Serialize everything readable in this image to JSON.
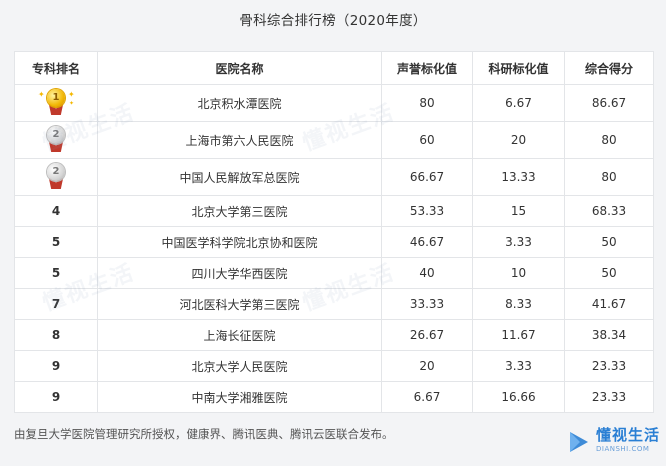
{
  "title": "骨科综合排行榜（2020年度）",
  "table": {
    "headers": [
      "专科排名",
      "医院名称",
      "声誉标化值",
      "科研标化值",
      "综合得分"
    ],
    "rows": [
      {
        "rank": "1",
        "medal": "gold",
        "name": "北京积水潭医院",
        "reputation": "80",
        "research": "6.67",
        "total": "86.67"
      },
      {
        "rank": "2",
        "medal": "silver",
        "name": "上海市第六人民医院",
        "reputation": "60",
        "research": "20",
        "total": "80"
      },
      {
        "rank": "2",
        "medal": "silver",
        "name": "中国人民解放军总医院",
        "reputation": "66.67",
        "research": "13.33",
        "total": "80"
      },
      {
        "rank": "4",
        "medal": "",
        "name": "北京大学第三医院",
        "reputation": "53.33",
        "research": "15",
        "total": "68.33"
      },
      {
        "rank": "5",
        "medal": "",
        "name": "中国医学科学院北京协和医院",
        "reputation": "46.67",
        "research": "3.33",
        "total": "50"
      },
      {
        "rank": "5",
        "medal": "",
        "name": "四川大学华西医院",
        "reputation": "40",
        "research": "10",
        "total": "50"
      },
      {
        "rank": "7",
        "medal": "",
        "name": "河北医科大学第三医院",
        "reputation": "33.33",
        "research": "8.33",
        "total": "41.67"
      },
      {
        "rank": "8",
        "medal": "",
        "name": "上海长征医院",
        "reputation": "26.67",
        "research": "11.67",
        "total": "38.34"
      },
      {
        "rank": "9",
        "medal": "",
        "name": "北京大学人民医院",
        "reputation": "20",
        "research": "3.33",
        "total": "23.33"
      },
      {
        "rank": "9",
        "medal": "",
        "name": "中南大学湘雅医院",
        "reputation": "6.67",
        "research": "16.66",
        "total": "23.33"
      }
    ]
  },
  "footer": "由复旦大学医院管理研究所授权，健康界、腾讯医典、腾讯云医联合发布。",
  "brand": {
    "name": "懂视生活",
    "sub": "DIANSHI.COM",
    "icon": "play-logo-icon",
    "color": "#2a7fd4"
  },
  "watermark_text": "懂视生活",
  "colors": {
    "gold": "#f2b705",
    "silver": "#cfcfcf",
    "ribbon": "#c0392b",
    "border": "#e3e5e8"
  }
}
